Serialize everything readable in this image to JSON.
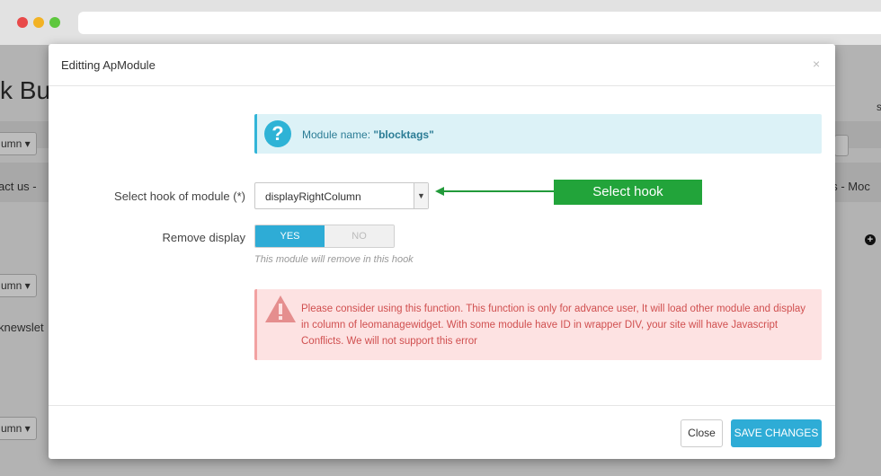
{
  "browser": {
    "url": ""
  },
  "background_page": {
    "title_fragment": "k Bui",
    "column_btn_1": "umn ▾",
    "column_btn_2": "umn ▾",
    "column_btn_3": "umn ▾",
    "contact_fragment": "act us -",
    "newsletter_fragment": "knewslet",
    "right_fragment": "gs - Moc",
    "right_char": "s"
  },
  "modal": {
    "title": "Editting ApModule",
    "close_x": "×",
    "info": {
      "label": "Module name:",
      "value": "\"blocktags\""
    },
    "hook_field": {
      "label": "Select hook of module (*)",
      "selected": "displayRightColumn"
    },
    "callout": "Select hook",
    "remove_display": {
      "label": "Remove display",
      "yes": "YES",
      "no": "NO",
      "help": "This module will remove in this hook"
    },
    "warning": "Please consider using this function. This function is only for advance user, It will load other module and display in column of leomanagewidget. With some module have ID in wrapper DIV, your site will have Javascript Conflicts. We will not support this error",
    "footer": {
      "close_label": "Close",
      "save_label": "SAVE CHANGES"
    }
  },
  "colors": {
    "accent": "#2eacd6",
    "callout_green": "#22a43a",
    "info_bg": "#dcf2f7",
    "warning_bg": "#fde2e2",
    "warning_text": "#d04f4f"
  }
}
